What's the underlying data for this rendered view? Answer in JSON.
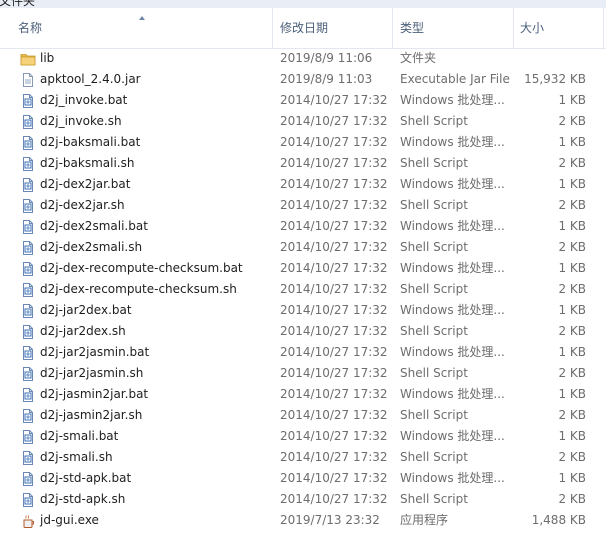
{
  "window": {
    "title": "文件夹"
  },
  "columns": {
    "name": "名称",
    "date": "修改日期",
    "type": "类型",
    "size": "大小"
  },
  "files": [
    {
      "icon": "folder-icon",
      "name": "lib",
      "date": "2019/8/9 11:06",
      "type": "文件夹",
      "size": ""
    },
    {
      "icon": "jar-file-icon",
      "name": "apktool_2.4.0.jar",
      "date": "2019/8/9 11:03",
      "type": "Executable Jar File",
      "size": "15,932 KB"
    },
    {
      "icon": "script-file-icon",
      "name": "d2j_invoke.bat",
      "date": "2014/10/27 17:32",
      "type": "Windows 批处理...",
      "size": "1 KB"
    },
    {
      "icon": "script-file-icon",
      "name": "d2j_invoke.sh",
      "date": "2014/10/27 17:32",
      "type": "Shell Script",
      "size": "2 KB"
    },
    {
      "icon": "script-file-icon",
      "name": "d2j-baksmali.bat",
      "date": "2014/10/27 17:32",
      "type": "Windows 批处理...",
      "size": "1 KB"
    },
    {
      "icon": "script-file-icon",
      "name": "d2j-baksmali.sh",
      "date": "2014/10/27 17:32",
      "type": "Shell Script",
      "size": "2 KB"
    },
    {
      "icon": "script-file-icon",
      "name": "d2j-dex2jar.bat",
      "date": "2014/10/27 17:32",
      "type": "Windows 批处理...",
      "size": "1 KB"
    },
    {
      "icon": "script-file-icon",
      "name": "d2j-dex2jar.sh",
      "date": "2014/10/27 17:32",
      "type": "Shell Script",
      "size": "2 KB"
    },
    {
      "icon": "script-file-icon",
      "name": "d2j-dex2smali.bat",
      "date": "2014/10/27 17:32",
      "type": "Windows 批处理...",
      "size": "1 KB"
    },
    {
      "icon": "script-file-icon",
      "name": "d2j-dex2smali.sh",
      "date": "2014/10/27 17:32",
      "type": "Shell Script",
      "size": "2 KB"
    },
    {
      "icon": "script-file-icon",
      "name": "d2j-dex-recompute-checksum.bat",
      "date": "2014/10/27 17:32",
      "type": "Windows 批处理...",
      "size": "1 KB"
    },
    {
      "icon": "script-file-icon",
      "name": "d2j-dex-recompute-checksum.sh",
      "date": "2014/10/27 17:32",
      "type": "Shell Script",
      "size": "2 KB"
    },
    {
      "icon": "script-file-icon",
      "name": "d2j-jar2dex.bat",
      "date": "2014/10/27 17:32",
      "type": "Windows 批处理...",
      "size": "1 KB"
    },
    {
      "icon": "script-file-icon",
      "name": "d2j-jar2dex.sh",
      "date": "2014/10/27 17:32",
      "type": "Shell Script",
      "size": "2 KB"
    },
    {
      "icon": "script-file-icon",
      "name": "d2j-jar2jasmin.bat",
      "date": "2014/10/27 17:32",
      "type": "Windows 批处理...",
      "size": "1 KB"
    },
    {
      "icon": "script-file-icon",
      "name": "d2j-jar2jasmin.sh",
      "date": "2014/10/27 17:32",
      "type": "Shell Script",
      "size": "2 KB"
    },
    {
      "icon": "script-file-icon",
      "name": "d2j-jasmin2jar.bat",
      "date": "2014/10/27 17:32",
      "type": "Windows 批处理...",
      "size": "1 KB"
    },
    {
      "icon": "script-file-icon",
      "name": "d2j-jasmin2jar.sh",
      "date": "2014/10/27 17:32",
      "type": "Shell Script",
      "size": "2 KB"
    },
    {
      "icon": "script-file-icon",
      "name": "d2j-smali.bat",
      "date": "2014/10/27 17:32",
      "type": "Windows 批处理...",
      "size": "1 KB"
    },
    {
      "icon": "script-file-icon",
      "name": "d2j-smali.sh",
      "date": "2014/10/27 17:32",
      "type": "Shell Script",
      "size": "2 KB"
    },
    {
      "icon": "script-file-icon",
      "name": "d2j-std-apk.bat",
      "date": "2014/10/27 17:32",
      "type": "Windows 批处理...",
      "size": "1 KB"
    },
    {
      "icon": "script-file-icon",
      "name": "d2j-std-apk.sh",
      "date": "2014/10/27 17:32",
      "type": "Shell Script",
      "size": "2 KB"
    },
    {
      "icon": "exe-file-icon",
      "name": "jd-gui.exe",
      "date": "2019/7/13 23:32",
      "type": "应用程序",
      "size": "1,488 KB"
    }
  ]
}
